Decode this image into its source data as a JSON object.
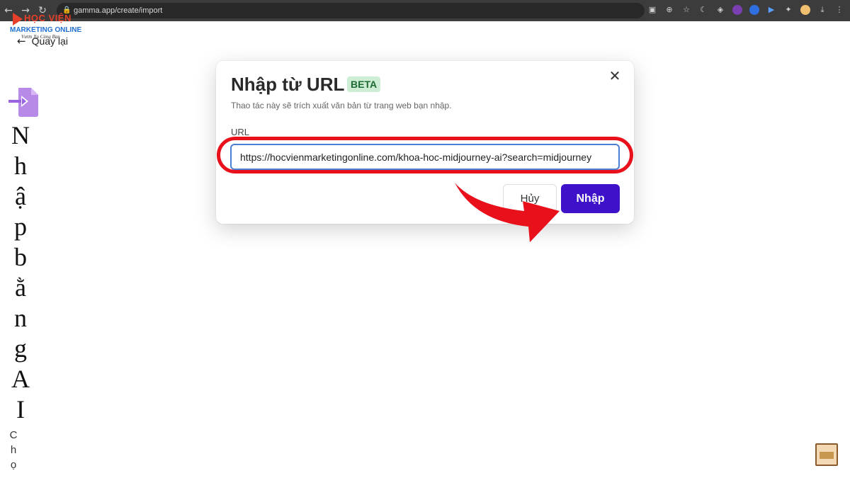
{
  "browser": {
    "url": "gamma.app/create/import"
  },
  "logo": {
    "line1": "HỌC VIỆN",
    "line2": "MARKETING ONLINE",
    "line3": "Vươn Xa Cùng Bạn"
  },
  "back_label": "Quay lại",
  "side": {
    "title_chars": [
      "N",
      "h",
      "ậ",
      "p",
      "b",
      "ằ",
      "n",
      "g",
      "A",
      "I"
    ],
    "subtitle_chars": [
      "C",
      "h",
      "ọ"
    ]
  },
  "modal": {
    "title": "Nhập từ URL",
    "badge": "BETA",
    "description": "Thao tác này sẽ trích xuất văn bản từ trang web bạn nhập.",
    "url_label": "URL",
    "url_value": "https://hocvienmarketingonline.com/khoa-hoc-midjourney-ai?search=midjourney",
    "cancel_label": "Hủy",
    "import_label": "Nhập"
  },
  "colors": {
    "primary": "#3d12c9",
    "annotation": "#e8101a",
    "beta_bg": "#cdeed5"
  }
}
